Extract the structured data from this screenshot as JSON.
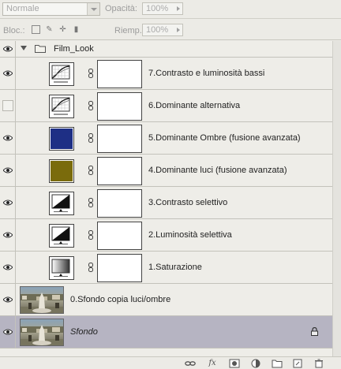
{
  "options": {
    "blend_mode": "Normale",
    "opacity_label": "Opacità:",
    "opacity_value": "100%",
    "lock_label": "Bloc.:",
    "fill_label": "Riemp.:",
    "fill_value": "100%"
  },
  "group": {
    "name": "Film_Look",
    "expanded": true,
    "visible": true
  },
  "adjustment_layers": [
    {
      "name": "7.Contrasto e luminosità bassi",
      "visible": true,
      "icon": "curves-icon"
    },
    {
      "name": "6.Dominante alternativa",
      "visible": false,
      "icon": "curves-icon"
    },
    {
      "name": "5.Dominante Ombre (fusione avanzata)",
      "visible": true,
      "icon": "color-fill-icon",
      "color": "#1e2f85"
    },
    {
      "name": "4.Dominante luci (fusione avanzata)",
      "visible": true,
      "icon": "color-fill-icon",
      "color": "#7a6b0c"
    },
    {
      "name": "3.Contrasto selettivo",
      "visible": true,
      "icon": "levels-icon"
    },
    {
      "name": "2.Luminosità selettiva",
      "visible": true,
      "icon": "levels-icon"
    },
    {
      "name": "1.Saturazione",
      "visible": true,
      "icon": "gradient-map-icon"
    }
  ],
  "pixel_layers": [
    {
      "name": "0.Sfondo copia luci/ombre",
      "visible": true,
      "selected": false,
      "locked": false
    },
    {
      "name": "Sfondo",
      "visible": true,
      "selected": true,
      "locked": true
    }
  ],
  "bottom_toolbar": [
    "link-icon",
    "fx-icon",
    "mask-icon",
    "adjustment-icon",
    "folder-icon",
    "new-layer-icon",
    "trash-icon"
  ]
}
